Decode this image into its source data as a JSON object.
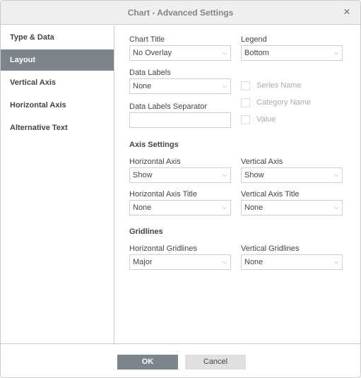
{
  "dialog": {
    "title": "Chart - Advanced Settings",
    "close_icon": "×"
  },
  "sidebar": {
    "items": [
      {
        "label": "Type & Data",
        "active": false
      },
      {
        "label": "Layout",
        "active": true
      },
      {
        "label": "Vertical Axis",
        "active": false
      },
      {
        "label": "Horizontal Axis",
        "active": false
      },
      {
        "label": "Alternative Text",
        "active": false
      }
    ]
  },
  "layout": {
    "chart_title": {
      "label": "Chart Title",
      "value": "No Overlay"
    },
    "legend": {
      "label": "Legend",
      "value": "Bottom"
    },
    "data_labels": {
      "label": "Data Labels",
      "value": "None"
    },
    "data_labels_separator": {
      "label": "Data Labels Separator",
      "value": ""
    },
    "checkboxes": [
      {
        "label": "Series Name",
        "checked": false
      },
      {
        "label": "Category Name",
        "checked": false
      },
      {
        "label": "Value",
        "checked": false
      }
    ],
    "axis_settings": {
      "heading": "Axis Settings",
      "horizontal_axis": {
        "label": "Horizontal Axis",
        "value": "Show"
      },
      "vertical_axis": {
        "label": "Vertical Axis",
        "value": "Show"
      },
      "horizontal_axis_title": {
        "label": "Horizontal Axis Title",
        "value": "None"
      },
      "vertical_axis_title": {
        "label": "Vertical Axis Title",
        "value": "None"
      }
    },
    "gridlines": {
      "heading": "Gridlines",
      "horizontal": {
        "label": "Horizontal Gridlines",
        "value": "Major"
      },
      "vertical": {
        "label": "Vertical Gridlines",
        "value": "None"
      }
    }
  },
  "footer": {
    "ok_label": "OK",
    "cancel_label": "Cancel"
  },
  "icons": {
    "dropdown_arrow": "⌵"
  }
}
